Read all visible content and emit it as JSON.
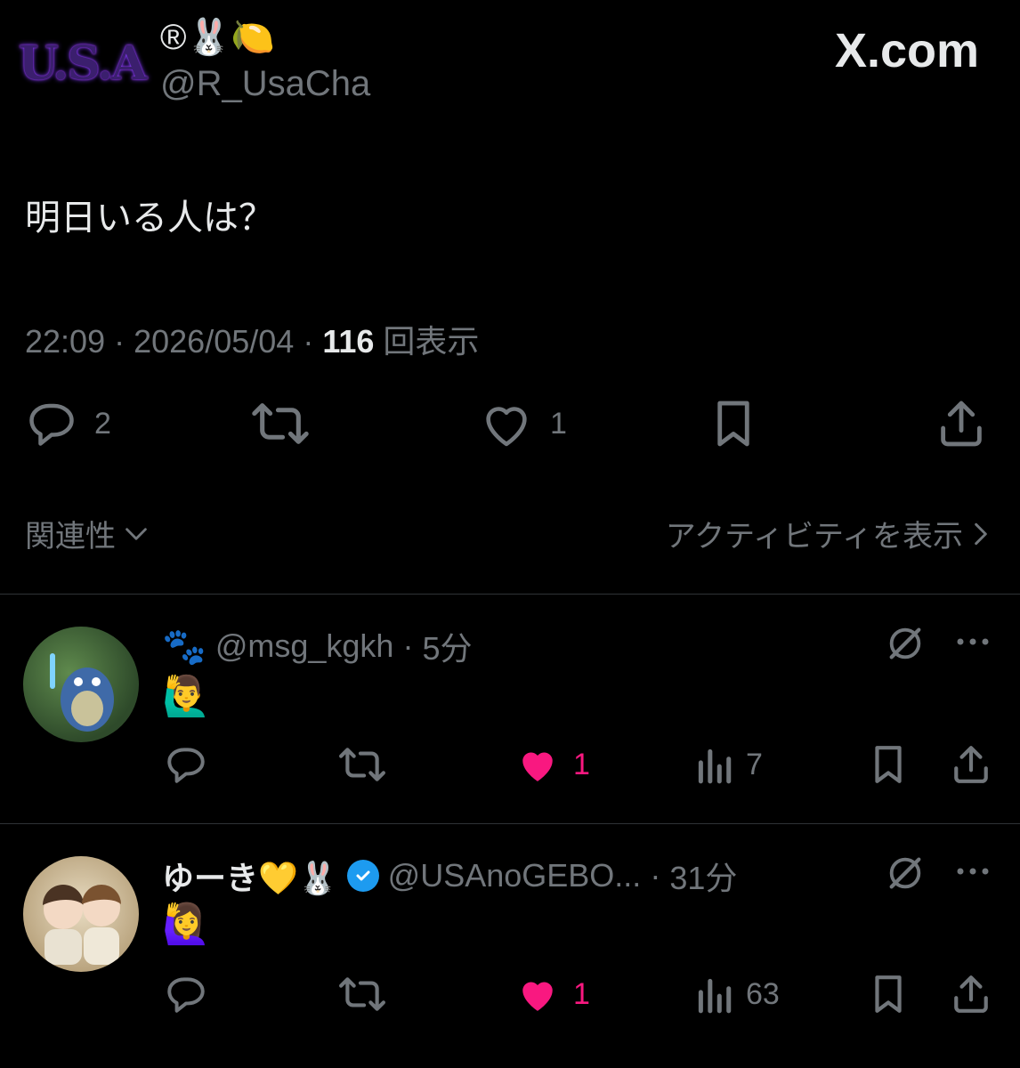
{
  "tweet": {
    "avatar_text": "U.S.A",
    "display_name": "®🐰🍋",
    "handle": "@R_UsaCha",
    "brand": "X.com",
    "text": "明日いる人は？",
    "time": "22:09",
    "date": "2026/05/04",
    "views_count": "116",
    "views_label": "回表示",
    "actions": {
      "replies": "2",
      "retweets": "",
      "likes": "1"
    }
  },
  "filters": {
    "sort_label": "関連性",
    "activity_label": "アクティビティを表示"
  },
  "replies": [
    {
      "name": "🐾",
      "handle": "@msg_kgkh",
      "time": "5分",
      "text": "🙋‍♂️",
      "likes": "1",
      "views": "7",
      "verified": false
    },
    {
      "name": "ゆーき💛🐰",
      "handle": "@USAnoGEBO...",
      "time": "31分",
      "text": "🙋‍♀️",
      "likes": "1",
      "views": "63",
      "verified": true
    }
  ],
  "colors": {
    "background": "#000000",
    "text": "#e7e9ea",
    "muted": "#71767b",
    "like": "#f91880",
    "verified": "#1d9bf0"
  }
}
